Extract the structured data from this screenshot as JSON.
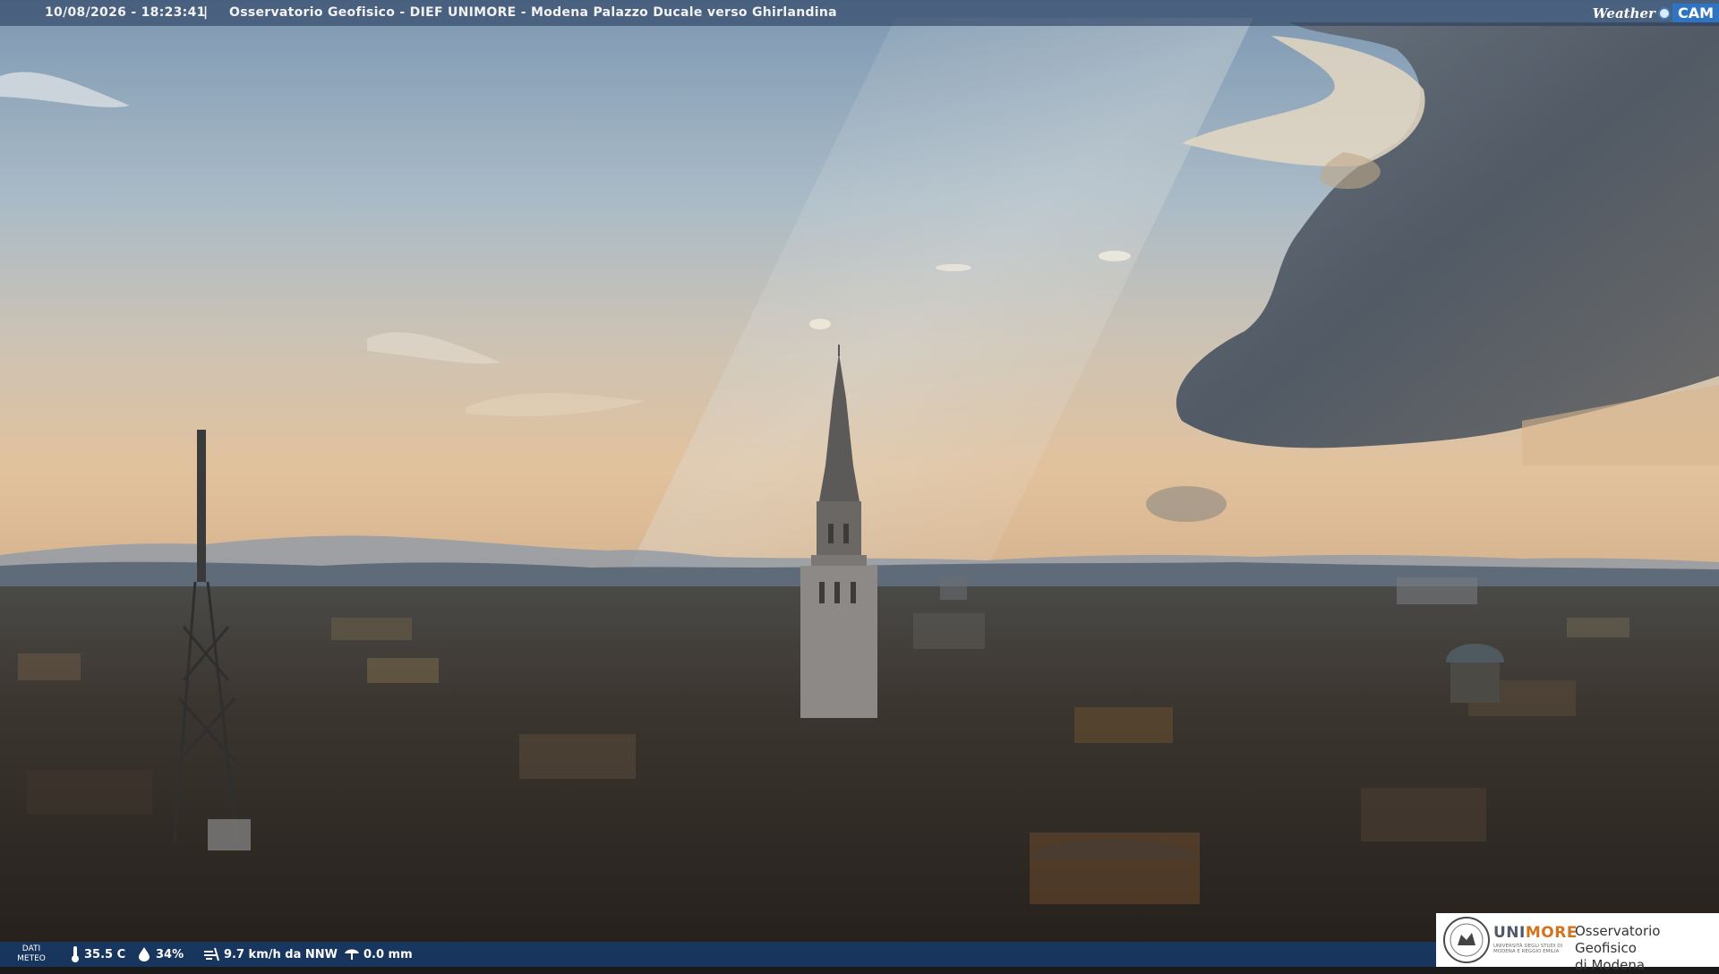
{
  "overlay": {
    "timestamp": "10/08/2026 - 18:23:41",
    "separator": "|",
    "title": "Osservatorio Geofisico - DIEF UNIMORE - Modena Palazzo Ducale verso Ghirlandina",
    "brand_weather": "Weather",
    "brand_cam": "CAM"
  },
  "weather": {
    "label_line1": "DATI",
    "label_line2": "METEO",
    "temperature": "35.5 C",
    "humidity": "34%",
    "wind": "9.7 km/h da NNW",
    "rain": "0.0 mm"
  },
  "logo": {
    "uni_prefix": "UNI",
    "uni_suffix": "MORE",
    "uni_sub": "UNIVERSITÀ DEGLI STUDI DI MODENA E REGGIO EMILIA",
    "observatory_line1": "Osservatorio Geofisico",
    "observatory_line2": "di Modena"
  },
  "colors": {
    "sky_top": "#7f9bb5",
    "sky_horizon": "#d9bd99",
    "cloud_dark": "#4f5762",
    "city_dark": "#2a2724",
    "weather_bar": "#163a6c",
    "unimore_orange": "#d4731f"
  },
  "icons": [
    "thermometer-icon",
    "humidity-drop-icon",
    "wind-icon",
    "rain-umbrella-icon",
    "weathercam-logo",
    "unimore-seal"
  ]
}
